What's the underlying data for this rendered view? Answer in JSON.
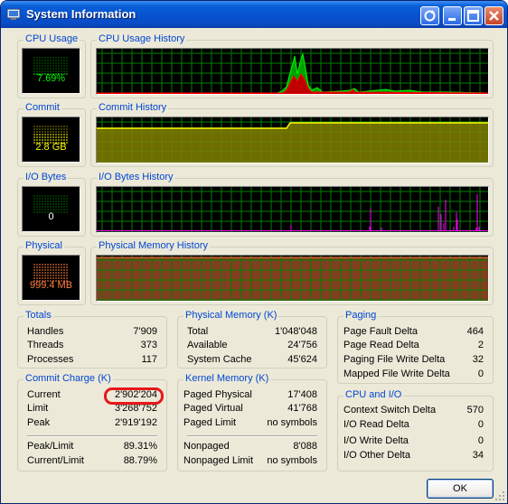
{
  "window": {
    "title": "System Information"
  },
  "meters": {
    "cpu": {
      "label": "CPU Usage",
      "value": "7.69%",
      "color": "#00ff00"
    },
    "commit": {
      "label": "Commit",
      "value": "2.8 GB",
      "color": "#ffff00"
    },
    "io": {
      "label": "I/O Bytes",
      "value": "0",
      "color": "#00ff00"
    },
    "physical": {
      "label": "Physical",
      "value": "999.4 MB",
      "color": "#ff8040"
    }
  },
  "history": {
    "cpu": "CPU Usage History",
    "commit": "Commit History",
    "io": "I/O Bytes History",
    "physical": "Physical Memory History"
  },
  "totals": {
    "label": "Totals",
    "rows": [
      {
        "k": "Handles",
        "v": "7'909"
      },
      {
        "k": "Threads",
        "v": "373"
      },
      {
        "k": "Processes",
        "v": "117"
      }
    ]
  },
  "physical_memory": {
    "label": "Physical Memory (K)",
    "rows": [
      {
        "k": "Total",
        "v": "1'048'048"
      },
      {
        "k": "Available",
        "v": "24'756"
      },
      {
        "k": "System Cache",
        "v": "45'624"
      }
    ]
  },
  "paging": {
    "label": "Paging",
    "rows": [
      {
        "k": "Page Fault Delta",
        "v": "464"
      },
      {
        "k": "Page Read Delta",
        "v": "2"
      },
      {
        "k": "Paging File Write Delta",
        "v": "32"
      },
      {
        "k": "Mapped File Write Delta",
        "v": "0"
      }
    ]
  },
  "commit_charge": {
    "label": "Commit Charge (K)",
    "rows": [
      {
        "k": "Current",
        "v": "2'902'204"
      },
      {
        "k": "Limit",
        "v": "3'268'752"
      },
      {
        "k": "Peak",
        "v": "2'919'192"
      }
    ],
    "rows2": [
      {
        "k": "Peak/Limit",
        "v": "89.31%"
      },
      {
        "k": "Current/Limit",
        "v": "88.79%"
      }
    ]
  },
  "kernel_memory": {
    "label": "Kernel Memory (K)",
    "rows": [
      {
        "k": "Paged Physical",
        "v": "17'408"
      },
      {
        "k": "Paged Virtual",
        "v": "41'768"
      },
      {
        "k": "Paged Limit",
        "v": "no symbols"
      }
    ],
    "rows2": [
      {
        "k": "Nonpaged",
        "v": "8'088"
      },
      {
        "k": "Nonpaged Limit",
        "v": "no symbols"
      }
    ]
  },
  "cpu_io": {
    "label": "CPU and I/O",
    "rows": [
      {
        "k": "Context Switch Delta",
        "v": "570"
      },
      {
        "k": "I/O Read Delta",
        "v": "0"
      },
      {
        "k": "I/O Write Delta",
        "v": "0"
      },
      {
        "k": "I/O Other Delta",
        "v": "34"
      }
    ]
  },
  "buttons": {
    "ok": "OK"
  },
  "colors": {
    "label_blue": "#0046d5",
    "grid_green": "#008000",
    "highlight_red": "#e8161a",
    "commit_fill": "#808000",
    "physical_fill": "#804020"
  }
}
